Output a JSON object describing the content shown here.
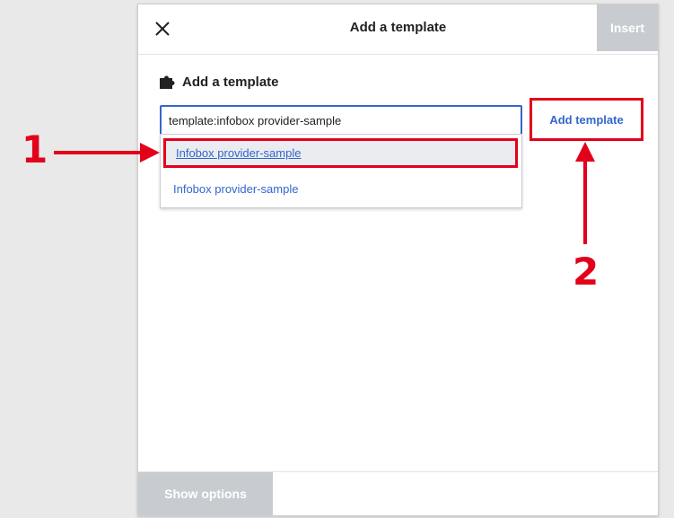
{
  "dialog": {
    "title": "Add a template",
    "insert_label": "Insert",
    "section_heading": "Add a template",
    "search_value": "template:infobox provider-sample",
    "add_template_label": "Add template",
    "suggestions": [
      "Infobox provider-sample",
      "Infobox provider-sample"
    ],
    "show_options_label": "Show options"
  },
  "annotations": {
    "callout_1": "1",
    "callout_2": "2"
  },
  "icons": {
    "close": "close-icon",
    "puzzle": "puzzle-piece-icon"
  },
  "colors": {
    "accent": "#3366cc",
    "annotation_red": "#e3001b",
    "disabled_button": "#c8ccd1"
  }
}
